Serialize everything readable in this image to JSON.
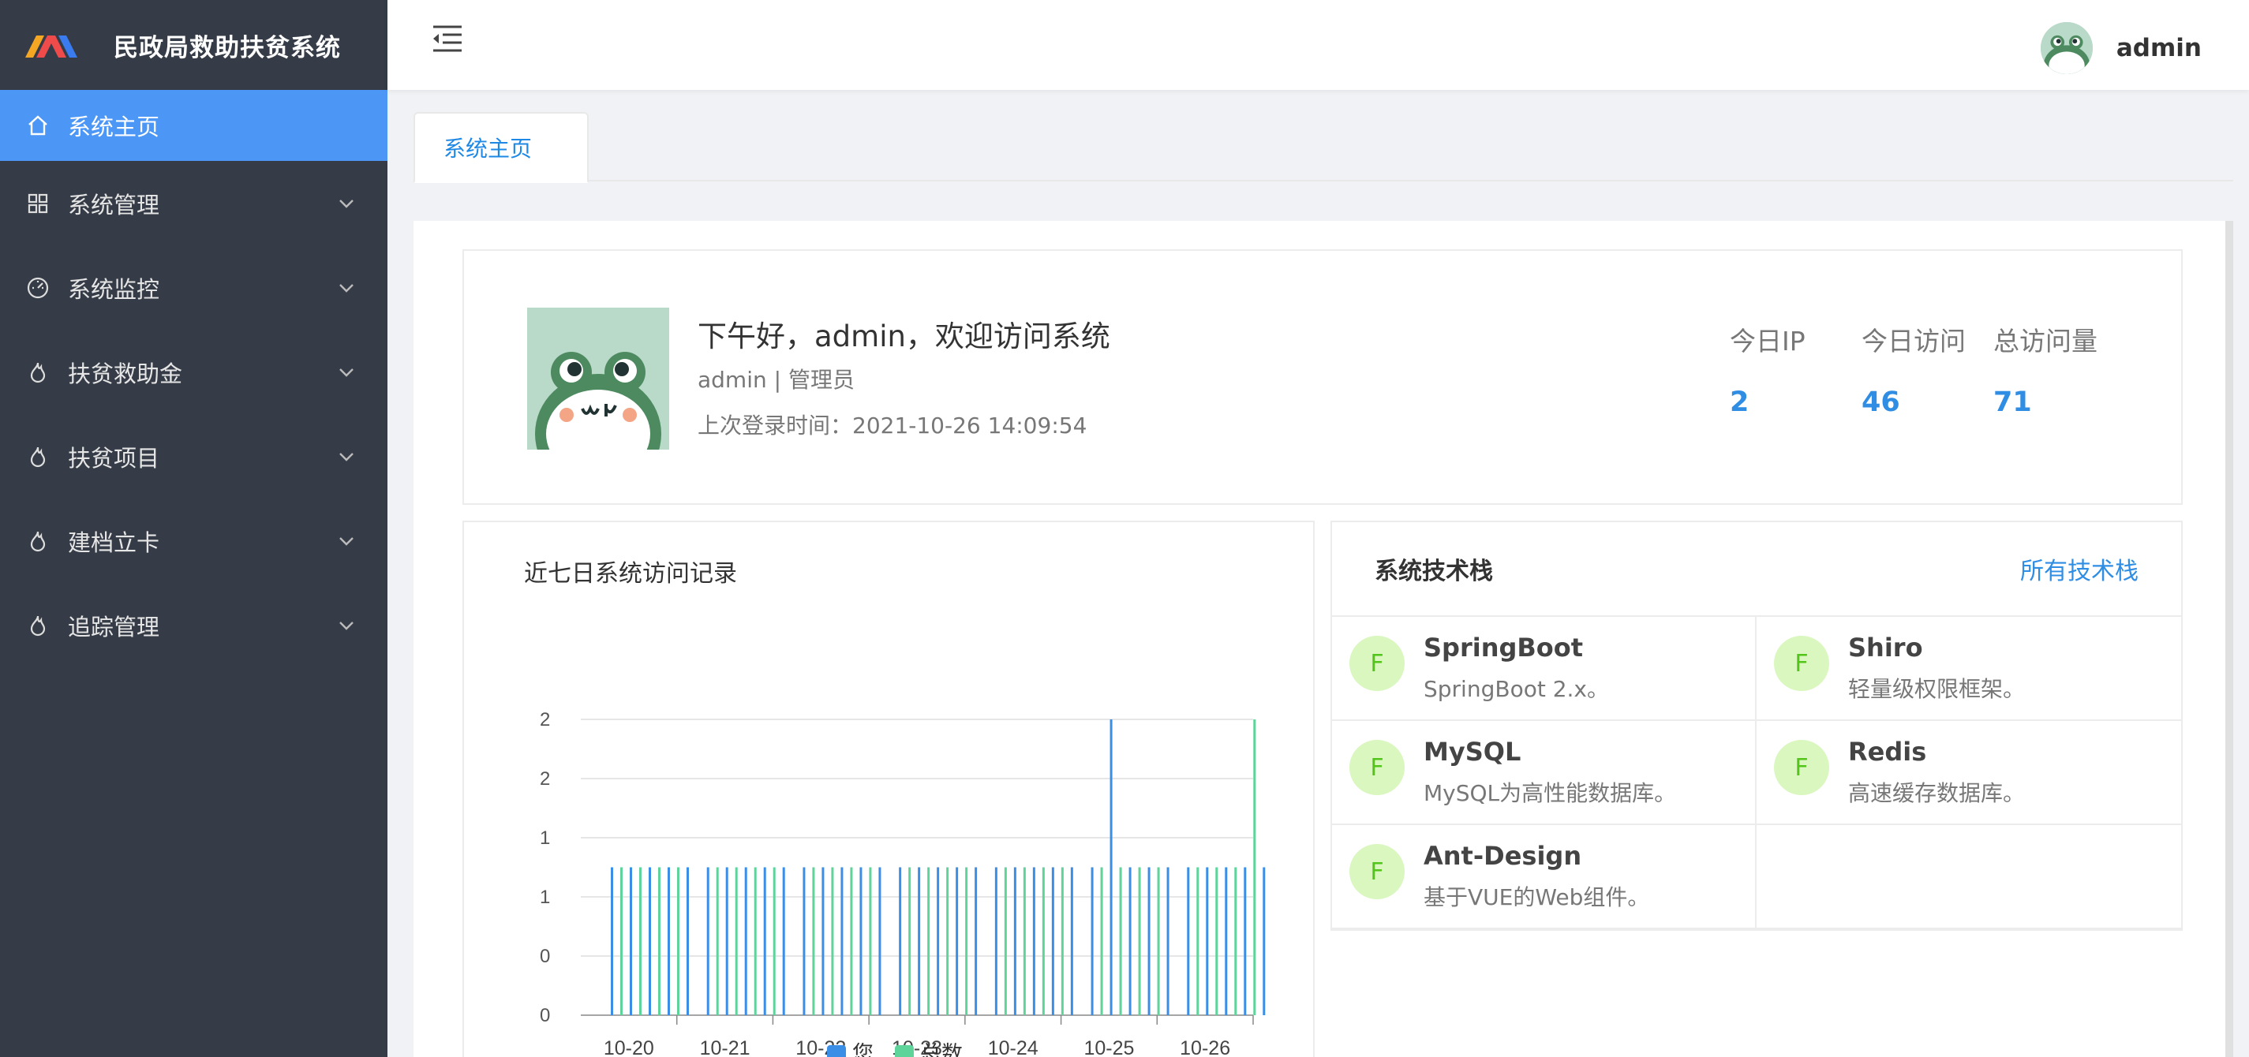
{
  "app": {
    "title": "民政局救助扶贫系统"
  },
  "sidebar": {
    "items": [
      {
        "label": "系统主页",
        "icon": "home-icon",
        "active": true
      },
      {
        "label": "系统管理",
        "icon": "grid-icon"
      },
      {
        "label": "系统监控",
        "icon": "dashboard-icon"
      },
      {
        "label": "扶贫救助金",
        "icon": "fire-icon"
      },
      {
        "label": "扶贫项目",
        "icon": "fire-icon"
      },
      {
        "label": "建档立卡",
        "icon": "fire-icon"
      },
      {
        "label": "追踪管理",
        "icon": "fire-icon"
      }
    ]
  },
  "header": {
    "username": "admin"
  },
  "tabs": [
    {
      "label": "系统主页"
    }
  ],
  "welcome": {
    "greeting": "下午好，admin，欢迎访问系统",
    "role": "admin | 管理员",
    "last_login": "上次登录时间：2021-10-26 14:09:54"
  },
  "stats": [
    {
      "label": "今日IP",
      "value": "2"
    },
    {
      "label": "今日访问",
      "value": "46"
    },
    {
      "label": "总访问量",
      "value": "71"
    }
  ],
  "chart": {
    "title": "近七日系统访问记录"
  },
  "chart_data": {
    "type": "bar",
    "title": "近七日系统访问记录",
    "categories": [
      "10-20",
      "10-21",
      "10-22",
      "10-23",
      "10-24",
      "10-25",
      "10-26"
    ],
    "y_tick_labels": [
      "0",
      "0",
      "1",
      "1",
      "2",
      "2"
    ],
    "ylim": [
      0,
      2.5
    ],
    "series": [
      {
        "name": "您",
        "color": "#3a8ee6",
        "values": [
          1.25,
          1.25,
          1.25,
          1.25,
          1.25,
          2.5,
          1.25
        ]
      },
      {
        "name": "总数",
        "color": "#5ed49b",
        "values": [
          1.25,
          1.25,
          1.25,
          1.25,
          1.25,
          1.25,
          2.5
        ]
      }
    ],
    "legend": "bottom",
    "grid": true
  },
  "tech": {
    "title": "系统技术栈",
    "link": "所有技术栈",
    "items": [
      {
        "badge": "F",
        "name": "SpringBoot",
        "desc": "SpringBoot 2.x。"
      },
      {
        "badge": "F",
        "name": "Shiro",
        "desc": "轻量级权限框架。"
      },
      {
        "badge": "F",
        "name": "MySQL",
        "desc": "MySQL为高性能数据库。"
      },
      {
        "badge": "F",
        "name": "Redis",
        "desc": "高速缓存数据库。"
      },
      {
        "badge": "F",
        "name": "Ant-Design",
        "desc": "基于VUE的Web组件。"
      }
    ]
  }
}
